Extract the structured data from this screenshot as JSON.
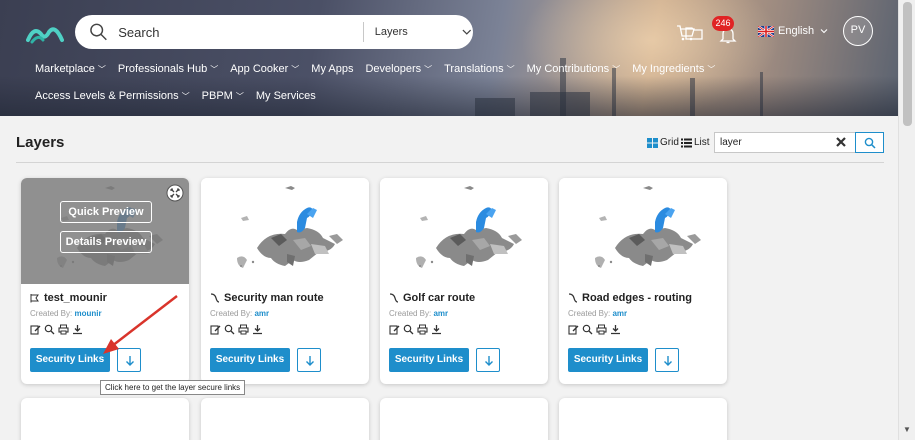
{
  "header": {
    "search_placeholder": "Search",
    "search_scope": "Layers",
    "notification_count": "246",
    "language": "English",
    "avatar_initials": "PV",
    "nav_row1": [
      {
        "label": "Marketplace",
        "dropdown": true
      },
      {
        "label": "Professionals Hub",
        "dropdown": true
      },
      {
        "label": "App Cooker",
        "dropdown": true
      },
      {
        "label": "My Apps",
        "dropdown": false
      },
      {
        "label": "Developers",
        "dropdown": true
      },
      {
        "label": "Translations",
        "dropdown": true
      },
      {
        "label": "My Contributions",
        "dropdown": true
      },
      {
        "label": "My Ingredients",
        "dropdown": true
      }
    ],
    "nav_row2": [
      {
        "label": "Access Levels & Permissions",
        "dropdown": true
      },
      {
        "label": "PBPM",
        "dropdown": true
      },
      {
        "label": "My Services",
        "dropdown": false
      }
    ]
  },
  "page": {
    "title": "Layers",
    "view_grid": "Grid",
    "view_list": "List",
    "filter_value": "layer"
  },
  "cards": [
    {
      "name": "test_mounir",
      "created_by_label": "Created By:",
      "author": "mounir",
      "security_label": "Security Links",
      "hovered": true,
      "quick_preview": "Quick Preview",
      "details_preview": "Details Preview"
    },
    {
      "name": "Security man route",
      "created_by_label": "Created By:",
      "author": "amr",
      "security_label": "Security Links",
      "hovered": false
    },
    {
      "name": "Golf car route",
      "created_by_label": "Created By:",
      "author": "amr",
      "security_label": "Security Links",
      "hovered": false
    },
    {
      "name": "Road edges - routing",
      "created_by_label": "Created By:",
      "author": "amr",
      "security_label": "Security Links",
      "hovered": false
    }
  ],
  "tooltip": "Click here to get the layer secure links",
  "colors": {
    "accent": "#1e8ecb",
    "badge": "#e02424",
    "arrow": "#d9342b",
    "map_gray": "#8a8a8a",
    "map_blue": "#2b8be0"
  }
}
